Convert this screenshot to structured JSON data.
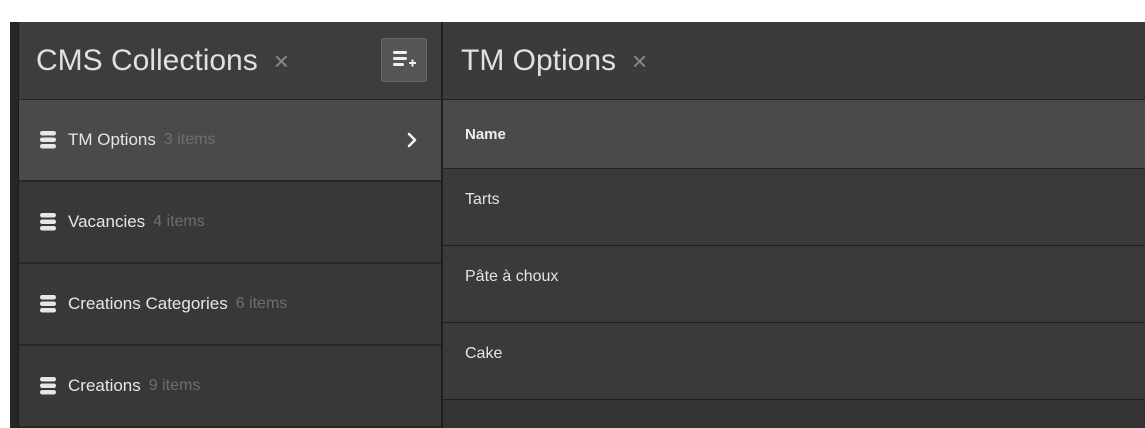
{
  "left_panel": {
    "title": "CMS Collections",
    "close_symbol": "×",
    "add_button_icon": "database-add-icon",
    "collections": [
      {
        "name": "TM Options",
        "count": "3 items",
        "active": true
      },
      {
        "name": "Vacancies",
        "count": "4 items",
        "active": false
      },
      {
        "name": "Creations Categories",
        "count": "6 items",
        "active": false
      },
      {
        "name": "Creations",
        "count": "9 items",
        "active": false
      }
    ]
  },
  "right_panel": {
    "title": "TM Options",
    "close_symbol": "×",
    "column_header": "Name",
    "rows": [
      {
        "name": "Tarts"
      },
      {
        "name": "Pâte à choux"
      },
      {
        "name": "Cake"
      }
    ]
  }
}
